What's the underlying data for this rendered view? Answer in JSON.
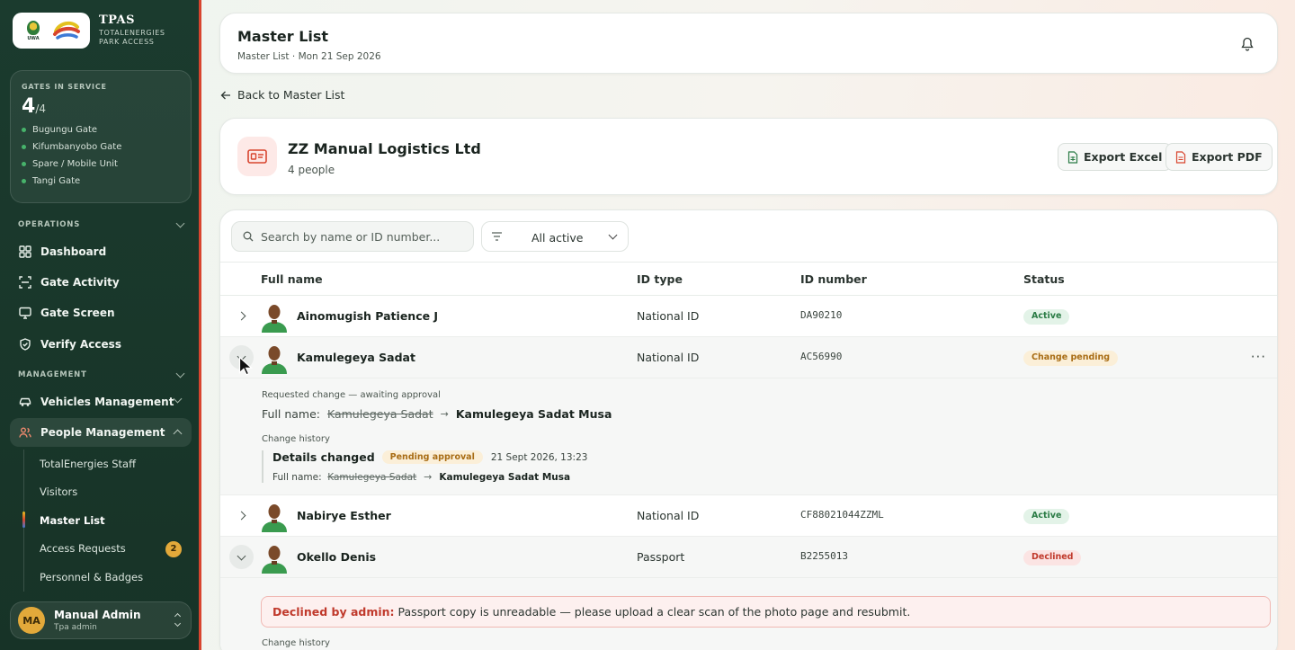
{
  "brand": {
    "title": "TPAS",
    "subtitle": "TOTALENERGIES PARK ACCESS",
    "uwa_text": "UWA"
  },
  "gates": {
    "label": "GATES IN SERVICE",
    "count": "4",
    "total": "/4",
    "items": [
      "Bugungu Gate",
      "Kifumbanyobo Gate",
      "Spare / Mobile Unit",
      "Tangi Gate"
    ]
  },
  "nav": {
    "operations_label": "OPERATIONS",
    "operations": [
      {
        "label": "Dashboard",
        "icon": "grid-icon"
      },
      {
        "label": "Gate Activity",
        "icon": "scan-icon"
      },
      {
        "label": "Gate Screen",
        "icon": "monitor-icon"
      },
      {
        "label": "Verify Access",
        "icon": "shield-check-icon"
      }
    ],
    "management_label": "MANAGEMENT",
    "vehicles": "Vehicles Management",
    "people": "People Management",
    "people_sub": [
      {
        "label": "TotalEnergies Staff"
      },
      {
        "label": "Visitors"
      },
      {
        "label": "Master List",
        "active": true
      },
      {
        "label": "Access Requests",
        "badge": "2"
      },
      {
        "label": "Personnel & Badges"
      }
    ]
  },
  "user": {
    "initials": "MA",
    "name": "Manual Admin",
    "role": "Tpa admin"
  },
  "header": {
    "title": "Master List",
    "subtitle": "Master List · Mon 21 Sep 2026"
  },
  "back": {
    "label": "Back to Master List"
  },
  "company": {
    "name": "ZZ Manual Logistics Ltd",
    "count": "4 people",
    "export_excel": "Export Excel",
    "export_pdf": "Export PDF"
  },
  "list": {
    "search_placeholder": "Search by name or ID number...",
    "filter": "All active",
    "columns": {
      "name": "Full name",
      "id_type": "ID type",
      "id_number": "ID number",
      "status": "Status"
    },
    "rows": [
      {
        "name": "Ainomugish Patience J",
        "id_type": "National ID",
        "id_number": "DA90210",
        "status": "Active"
      },
      {
        "name": "Kamulegeya Sadat",
        "id_type": "National ID",
        "id_number": "AC56990",
        "status": "Change pending"
      },
      {
        "name": "Nabirye Esther",
        "id_type": "National ID",
        "id_number": "CF88021044ZZML",
        "status": "Active"
      },
      {
        "name": "Okello Denis",
        "id_type": "Passport",
        "id_number": "B2255013",
        "status": "Declined"
      }
    ],
    "pending_detail": {
      "requested_label": "Requested change — awaiting approval",
      "field": "Full name:",
      "old": "Kamulegeya Sadat",
      "new": "Kamulegeya Sadat Musa",
      "history_label": "Change history",
      "history_title": "Details changed",
      "history_badge": "Pending approval",
      "history_time": "21 Sept 2026, 13:23",
      "history_field": "Full name:",
      "history_old": "Kamulegeya Sadat",
      "history_new": "Kamulegeya Sadat Musa"
    },
    "declined_detail": {
      "by": "Declined by admin:",
      "message": "Passport copy is unreadable — please upload a clear scan of the photo page and resubmit.",
      "history_label": "Change history"
    }
  },
  "colors": {
    "sidebar": "#1b3b2e",
    "accent_red": "#d8452f",
    "badge_gold": "#e3a93a",
    "active_green": "#2a7b45"
  }
}
